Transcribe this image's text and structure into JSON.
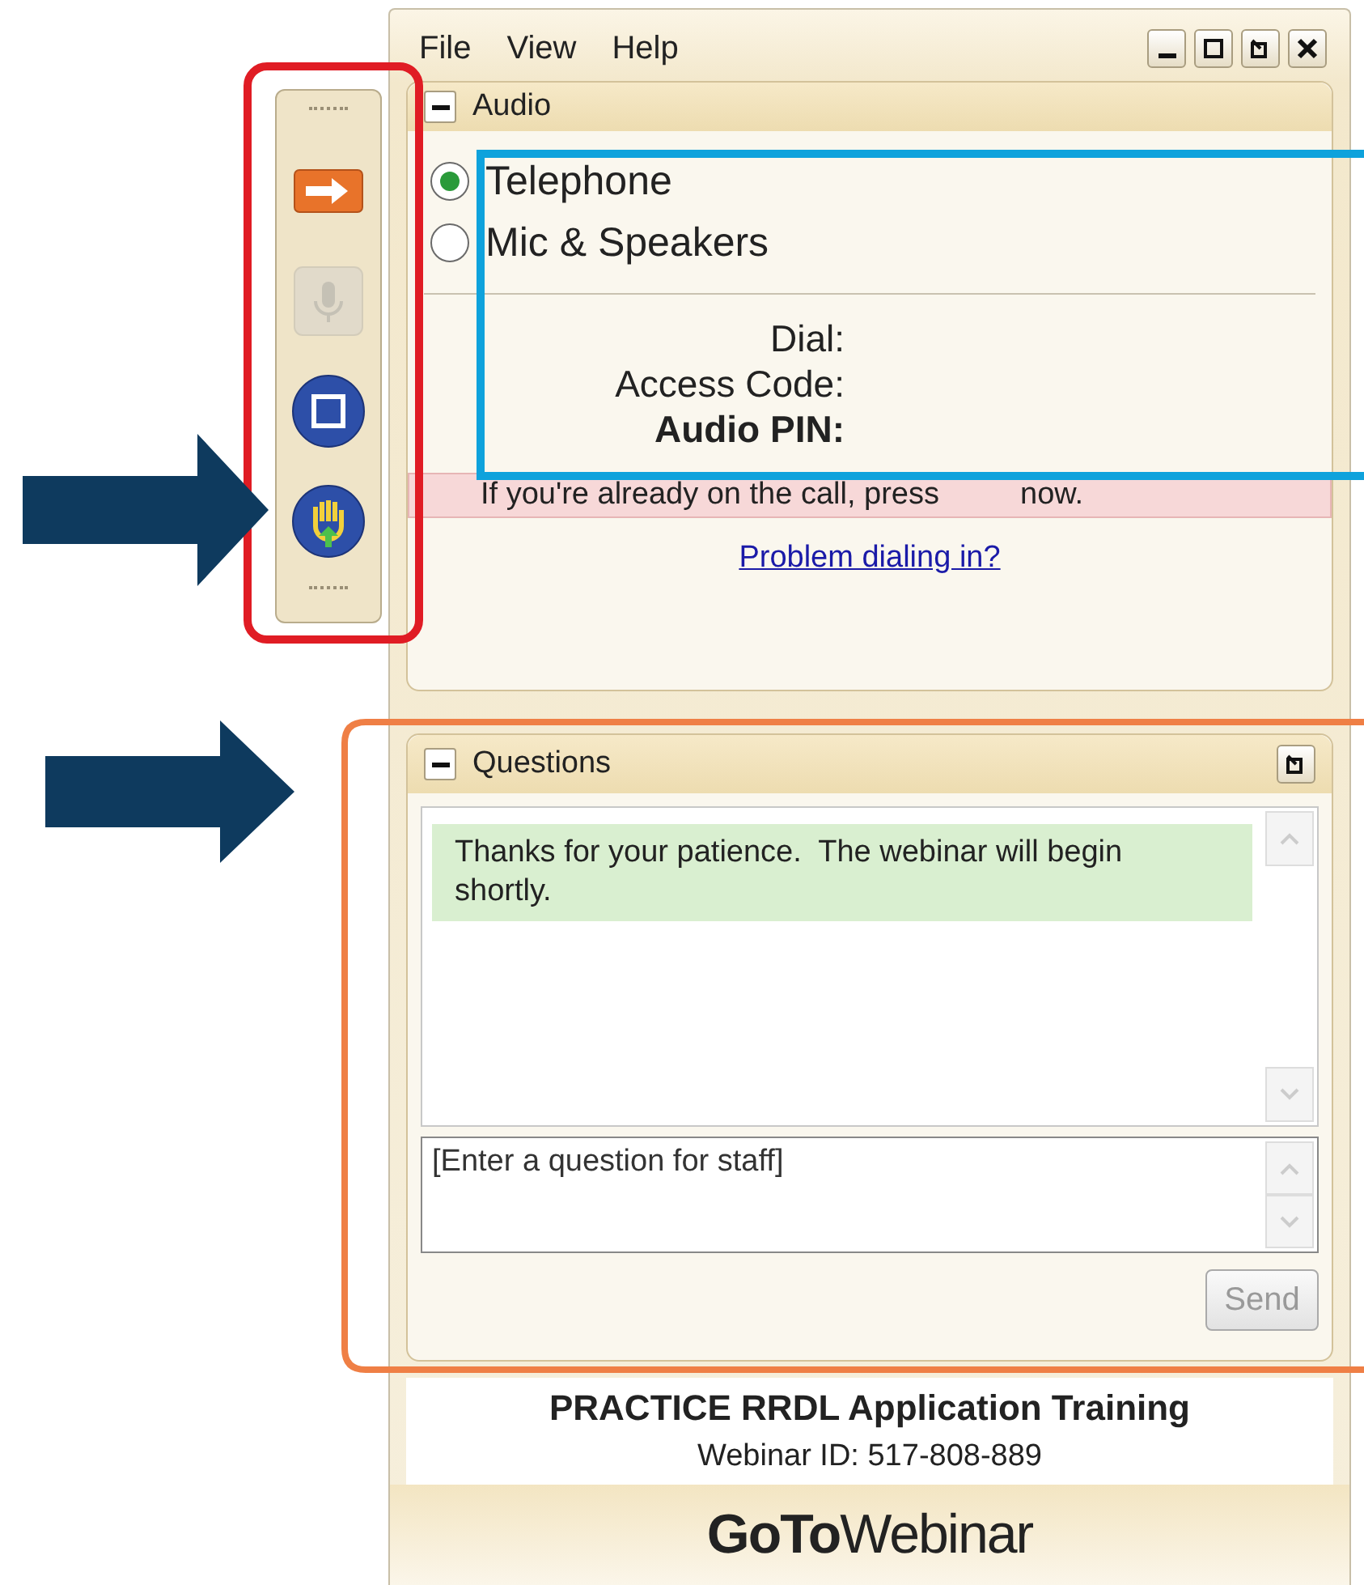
{
  "menu": [
    {
      "label": "File"
    },
    {
      "label": "View"
    },
    {
      "label": "Help"
    }
  ],
  "toolbar": [
    {
      "kind": "arrow",
      "disabled": false
    },
    {
      "kind": "mic",
      "disabled": true
    },
    {
      "kind": "screen",
      "disabled": false
    },
    {
      "kind": "hand",
      "disabled": false
    }
  ],
  "audio": {
    "title": "Audio",
    "expanded": true,
    "options": [
      {
        "label": "Telephone",
        "selected": true
      },
      {
        "label": "Mic & Speakers",
        "selected": false
      }
    ],
    "fields": [
      {
        "label": "Dial:",
        "emphasis": false
      },
      {
        "label": "Access Code:",
        "emphasis": false
      },
      {
        "label": "Audio PIN:",
        "emphasis": true
      }
    ],
    "notice": [
      "If you're already on the call, press",
      "now."
    ],
    "link": "Problem dialing in?"
  },
  "questions": {
    "title": "Questions",
    "expanded": true,
    "messages": [
      {
        "text": "Thanks for your patience.  The webinar will begin shortly."
      }
    ],
    "input": {
      "placeholder": "[Enter a question for staff]"
    },
    "send": {
      "label": "Send",
      "disabled": true
    }
  },
  "footer": {
    "title": "PRACTICE RRDL Application Training",
    "webinar_id": "Webinar ID: 517-808-889"
  },
  "logo": [
    "GoTo",
    "Webinar"
  ]
}
